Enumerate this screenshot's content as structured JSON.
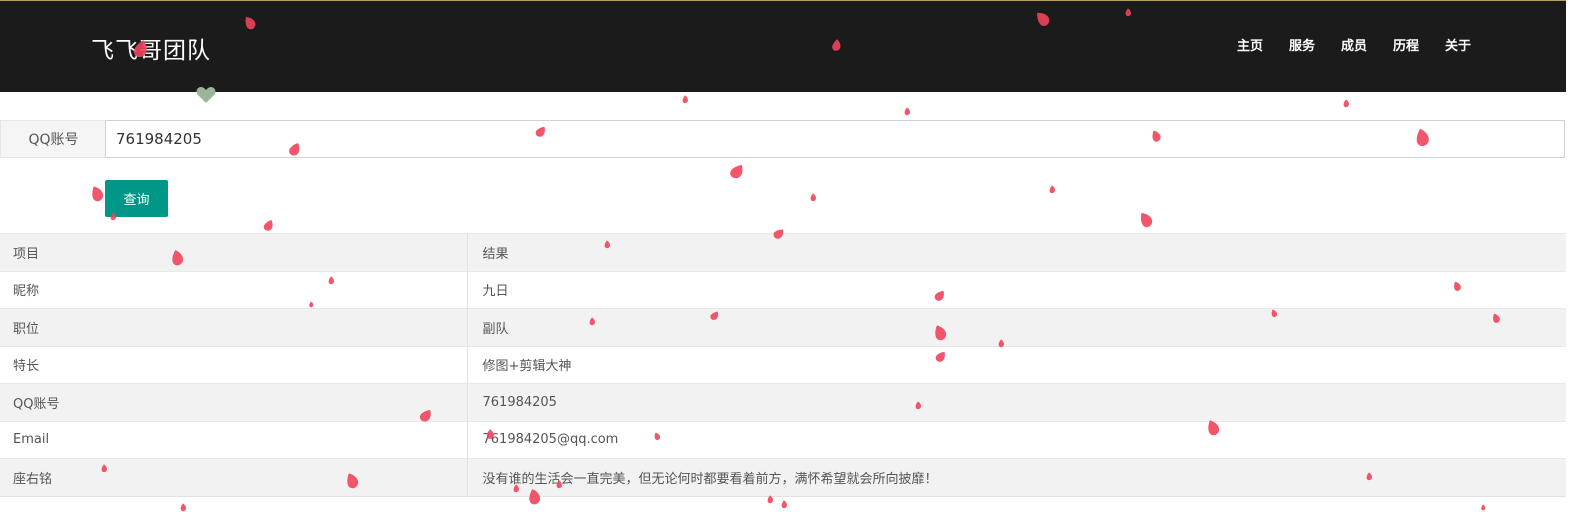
{
  "header": {
    "brand": "飞飞哥团队",
    "nav": [
      "主页",
      "服务",
      "成员",
      "历程",
      "关于"
    ]
  },
  "search": {
    "label": "QQ账号",
    "value": "761984205",
    "button": "查询"
  },
  "table": {
    "header": {
      "item": "项目",
      "result": "结果"
    },
    "rows": [
      {
        "item": "昵称",
        "result": "九日"
      },
      {
        "item": "职位",
        "result": "副队"
      },
      {
        "item": "特长",
        "result": "修图+剪辑大神"
      },
      {
        "item": "QQ账号",
        "result": "761984205"
      },
      {
        "item": "Email",
        "result": "761984205@qq.com"
      },
      {
        "item": "座右铭",
        "result": "没有谁的生活会一直完美，但无论何时都要看着前方，满怀希望就会所向披靡！"
      }
    ]
  },
  "colors": {
    "header_bg": "#1b1b1b",
    "button": "#009688",
    "petal": "#f0445c",
    "heart": "#9bb59a"
  },
  "icons": [
    "heart-icon",
    "petal-decoration"
  ]
}
